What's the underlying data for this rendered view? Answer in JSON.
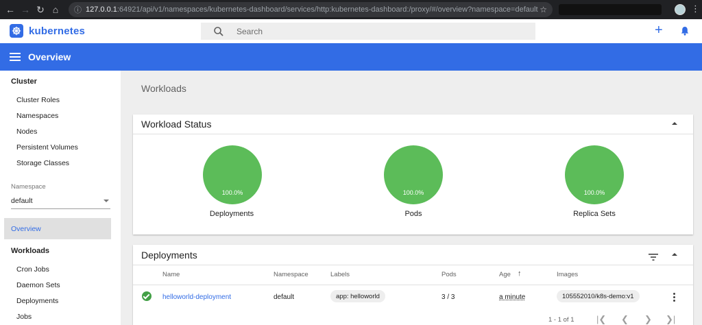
{
  "browser": {
    "url_host": "127.0.0.1",
    "url_rest": ":64921/api/v1/namespaces/kubernetes-dashboard/services/http:kubernetes-dashboard:/proxy/#/overview?namespace=default"
  },
  "header": {
    "logo_text": "kubernetes",
    "search_placeholder": "Search",
    "plus_symbol": "+"
  },
  "toolbar": {
    "title": "Overview"
  },
  "sidebar": {
    "cluster_heading": "Cluster",
    "cluster_items": [
      "Cluster Roles",
      "Namespaces",
      "Nodes",
      "Persistent Volumes",
      "Storage Classes"
    ],
    "namespace_label": "Namespace",
    "namespace_value": "default",
    "active_item": "Overview",
    "workloads_heading": "Workloads",
    "workload_items": [
      "Cron Jobs",
      "Daemon Sets",
      "Deployments",
      "Jobs"
    ]
  },
  "main": {
    "section_title": "Workloads",
    "workload_status": {
      "title": "Workload Status",
      "charts": [
        {
          "label": "Deployments",
          "percent": "100.0%",
          "value": 100,
          "color": "#5cbc59"
        },
        {
          "label": "Pods",
          "percent": "100.0%",
          "value": 100,
          "color": "#5cbc59"
        },
        {
          "label": "Replica Sets",
          "percent": "100.0%",
          "value": 100,
          "color": "#5cbc59"
        }
      ]
    },
    "deployments": {
      "title": "Deployments",
      "columns": [
        "Name",
        "Namespace",
        "Labels",
        "Pods",
        "Age",
        "Images"
      ],
      "sort_arrow": "↑",
      "rows": [
        {
          "status": "running",
          "name": "helloworld-deployment",
          "namespace": "default",
          "labels": "app: helloworld",
          "pods": "3 / 3",
          "age": "a minute",
          "images": "105552010/k8s-demo:v1"
        }
      ],
      "pagination": "1 - 1 of 1"
    }
  },
  "colors": {
    "accent": "#326ce5",
    "success": "#5cbc59"
  }
}
